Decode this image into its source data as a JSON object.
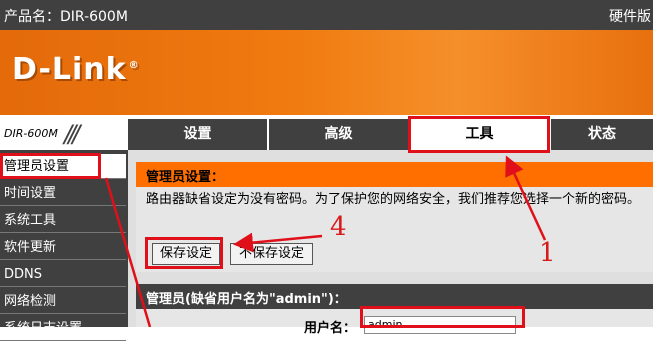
{
  "topbar": {
    "product": "产品名：DIR-600M",
    "hardware": "硬件版"
  },
  "logo": {
    "text": "D-Link",
    "reg": "®"
  },
  "model": {
    "name": "DIR-600M"
  },
  "nav_tabs": [
    "设置",
    "高级",
    "工具",
    "状态"
  ],
  "sidebar": [
    "管理员设置",
    "时间设置",
    "系统工具",
    "软件更新",
    "DDNS",
    "网络检测",
    "系统日志设置"
  ],
  "panel_admin": {
    "title": "管理员设置：",
    "description": "路由器缺省设定为没有密码。为了保护您的网络安全，我们推荐您选择一个新的密码。",
    "save": "保存设定",
    "dont_save": "不保存设定"
  },
  "panel_user": {
    "title": "管理员(缺省用户名为\"admin\")：",
    "username_label": "用户名：",
    "username_value": "admin"
  },
  "annotations": {
    "n1": "1",
    "n4": "4"
  },
  "colors": {
    "orange": "#f07b10",
    "dark": "#404040",
    "red": "#e0101a"
  }
}
